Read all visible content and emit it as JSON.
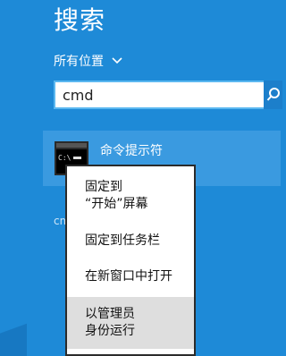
{
  "search": {
    "title": "搜索",
    "scope_label": "所有位置",
    "query": "cmd",
    "search_icon": "magnifier-icon"
  },
  "results": [
    {
      "label": "命令提示符",
      "icon": "command-prompt-icon"
    }
  ],
  "partial_text": "cm",
  "context_menu": {
    "items": [
      {
        "line1": "固定到",
        "line2": "“开始”屏幕"
      },
      {
        "line1": "固定到任务栏"
      },
      {
        "line1": "在新窗口中打开"
      },
      {
        "line1": "以管理员",
        "line2": "身份运行"
      }
    ]
  },
  "colors": {
    "background": "#1e8ad7",
    "result_highlight": "#3a9ae0",
    "search_button": "#1c7fcb",
    "menu_highlight": "#dedede"
  }
}
